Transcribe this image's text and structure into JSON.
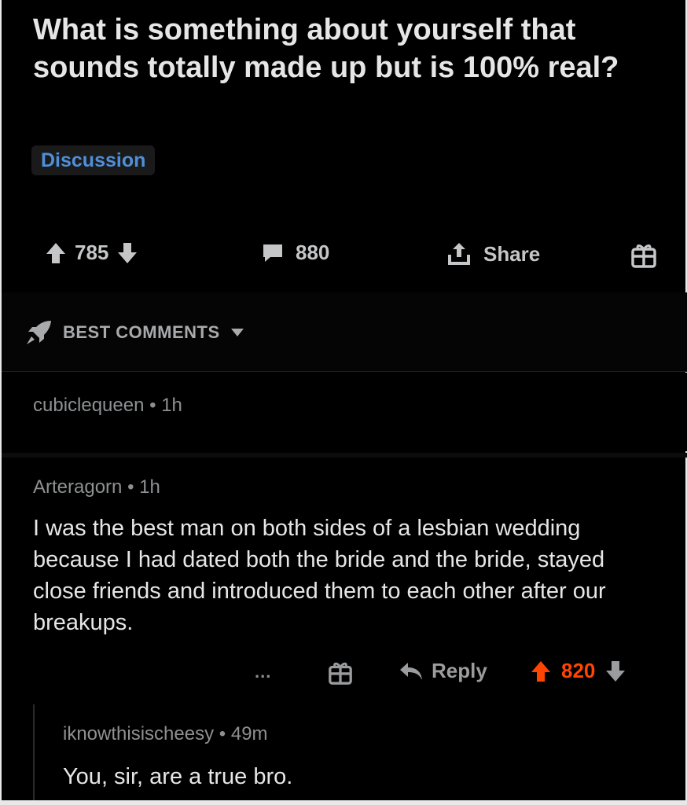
{
  "post": {
    "title": "What is something about yourself that sounds totally made up but is 100% real?",
    "flair": "Discussion",
    "upvotes": "785",
    "comments": "880",
    "share_label": "Share"
  },
  "sort": {
    "label": "BEST COMMENTS"
  },
  "collapsed_comment": {
    "author": "cubiclequeen",
    "age": "1h"
  },
  "comment": {
    "author": "Arteragorn",
    "age": "1h",
    "body": "I was the best man on both sides of a lesbian wedding because I had dated both the bride and the bride, stayed close friends and introduced them to each other after our breakups.",
    "more": "...",
    "reply_label": "Reply",
    "score": "820"
  },
  "reply": {
    "author": "iknowthisischeesy",
    "age": "49m",
    "body": "You, sir, are a true bro."
  },
  "colors": {
    "upvote_active": "#ff4500",
    "flair_text": "#4f8fd8",
    "background": "#000000"
  },
  "icons": {
    "upvote": "arrow-up-icon",
    "downvote": "arrow-down-icon",
    "comment": "speech-bubble-icon",
    "share": "share-icon",
    "gift": "gift-icon",
    "sort": "rocket-icon",
    "caret": "caret-down-icon",
    "reply": "reply-arrow-icon"
  }
}
